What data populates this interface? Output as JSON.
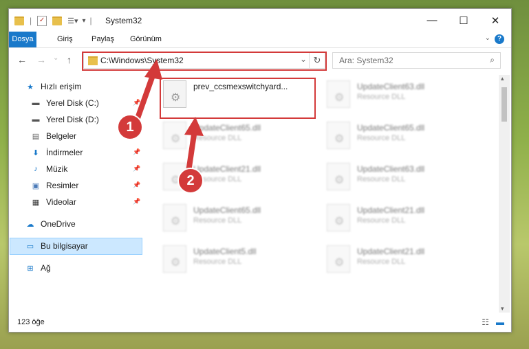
{
  "window": {
    "title": "System32",
    "minimize": "—",
    "maximize": "☐",
    "close": "✕"
  },
  "ribbon": {
    "tabs": [
      "Dosya",
      "Giriş",
      "Paylaş",
      "Görünüm"
    ],
    "help": "?"
  },
  "nav": {
    "address": "C:\\Windows\\System32",
    "search_placeholder": "Ara: System32"
  },
  "sidebar": {
    "items": [
      {
        "label": "Hızlı erişim",
        "icon": "star-icon"
      },
      {
        "label": "Yerel Disk (C:)",
        "icon": "drive-icon"
      },
      {
        "label": "Yerel Disk (D:)",
        "icon": "drive-icon"
      },
      {
        "label": "Belgeler",
        "icon": "documents-icon"
      },
      {
        "label": "İndirmeler",
        "icon": "download-icon"
      },
      {
        "label": "Müzik",
        "icon": "music-icon"
      },
      {
        "label": "Resimler",
        "icon": "pictures-icon"
      },
      {
        "label": "Videolar",
        "icon": "video-icon"
      },
      {
        "label": "OneDrive",
        "icon": "cloud-icon"
      },
      {
        "label": "Bu bilgisayar",
        "icon": "computer-icon"
      },
      {
        "label": "Ağ",
        "icon": "network-icon"
      }
    ]
  },
  "files": [
    {
      "name": "prev_ccsmexswitchyard...",
      "type": ""
    },
    {
      "name": "UpdateClient63.dll",
      "type": "Resource DLL"
    },
    {
      "name": "UpdateClient65.dll",
      "type": "Resource DLL"
    },
    {
      "name": "UpdateClient65.dll",
      "type": "Resource DLL"
    },
    {
      "name": "UpdateClient21.dll",
      "type": "Resource DLL"
    },
    {
      "name": "UpdateClient63.dll",
      "type": "Resource DLL"
    },
    {
      "name": "UpdateClient65.dll",
      "type": "Resource DLL"
    },
    {
      "name": "UpdateClient21.dll",
      "type": "Resource DLL"
    },
    {
      "name": "UpdateClient5.dll",
      "type": "Resource DLL"
    },
    {
      "name": "UpdateClient21.dll",
      "type": "Resource DLL"
    }
  ],
  "status": {
    "count": "123 öğe"
  },
  "annotations": {
    "badge1": "1",
    "badge2": "2",
    "color": "#d33a3a"
  }
}
